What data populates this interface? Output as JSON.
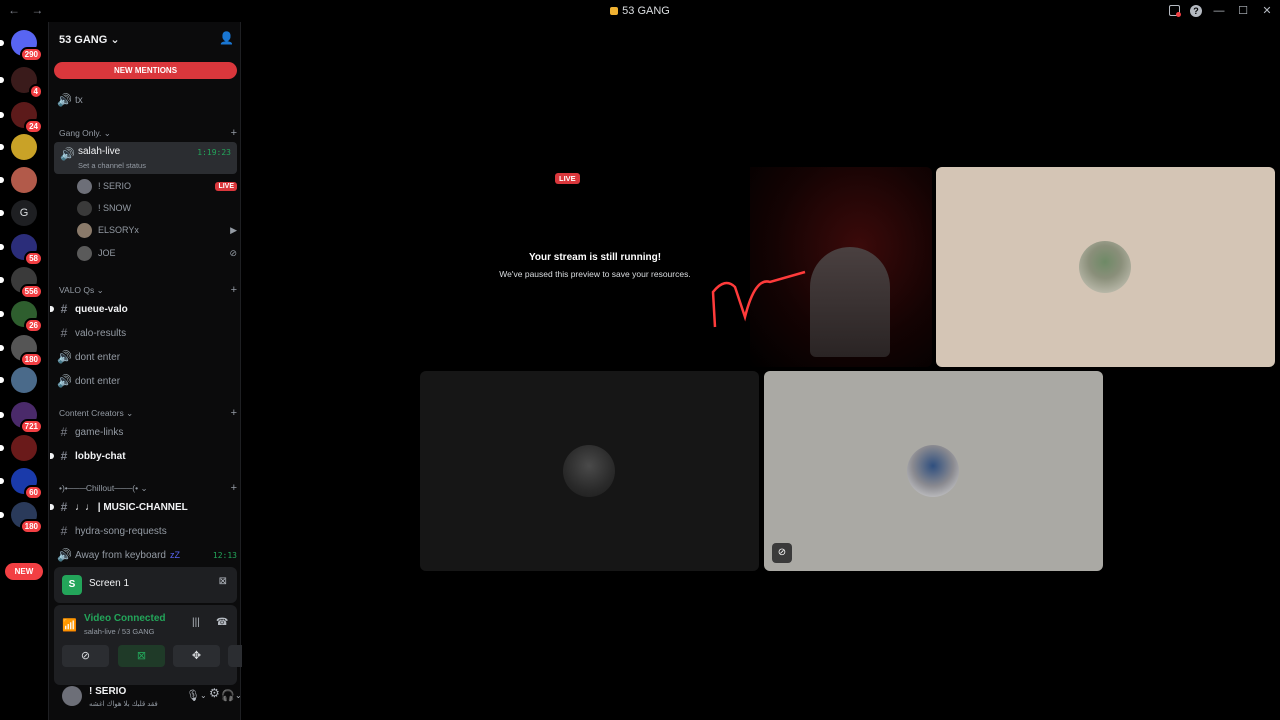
{
  "titlebar": {
    "title": "53 GANG",
    "back": "←",
    "forward": "→"
  },
  "guilds": [
    {
      "badge": "290",
      "color": "#5865f2"
    },
    {
      "badge": "4",
      "color": "#3a1b1b"
    },
    {
      "badge": "24",
      "color": "#5c1a1a"
    },
    {
      "badge": "",
      "color": "#c9a227"
    },
    {
      "badge": "",
      "color": "#b25a4a"
    },
    {
      "badge": "",
      "color": "#1e1f22",
      "letter": "G"
    },
    {
      "badge": "58",
      "color": "#2b2d7a"
    },
    {
      "badge": "556",
      "color": "#3a3a3a"
    },
    {
      "badge": "26",
      "color": "#2e5e2e"
    },
    {
      "badge": "180",
      "color": "#555555"
    },
    {
      "badge": "",
      "color": "#4a6a8a"
    },
    {
      "badge": "721",
      "color": "#4a2a6a"
    },
    {
      "badge": "",
      "color": "#6a1a1a"
    },
    {
      "badge": "60",
      "color": "#1a3aaa"
    },
    {
      "badge": "180",
      "color": "#2a3a5a"
    }
  ],
  "guild_new": "NEW",
  "server": {
    "name": "53 GANG",
    "new_mentions": "NEW MENTIONS"
  },
  "channels": {
    "tx": "tx",
    "cat_gang": "Gang Only.",
    "active": {
      "name": "salah-live",
      "status": "Set a channel status",
      "time": "1:19:23"
    },
    "voice_users": [
      {
        "name": "! SERIO",
        "live": "LIVE",
        "color": "#6d6f78"
      },
      {
        "name": "! SNOW",
        "color": "#3a3a3a"
      },
      {
        "name": "ELSORYx",
        "color": "#8a7a6a"
      },
      {
        "name": "JOE",
        "color": "#5a5a5a"
      }
    ],
    "cat_valo": "VALO Qs",
    "queue_valo": "queue-valo",
    "valo_results": "valo-results",
    "dont_enter_1": "dont enter",
    "dont_enter_2": "dont enter",
    "cat_cc": "Content Creators",
    "game_links": "game-links",
    "lobby_chat": "lobby-chat",
    "cat_chill": "•)•───Chillout───(•",
    "music": "♩♩ | MUSIC-CHANNEL",
    "hydra": "hydra-song-requests",
    "afk": "Away from keyboard",
    "afk_time": "12:13"
  },
  "screen_panel": {
    "label": "Screen 1"
  },
  "voice_connected": {
    "title": "Video Connected",
    "sub": "salah-live / 53 GANG"
  },
  "user": {
    "name": "! SERIO",
    "status": "فقد قلبك بلا هواك اغشه"
  },
  "stream": {
    "live": "LIVE",
    "msg1": "Your stream is still running!",
    "msg2": "We've paused this preview to save your resources."
  }
}
